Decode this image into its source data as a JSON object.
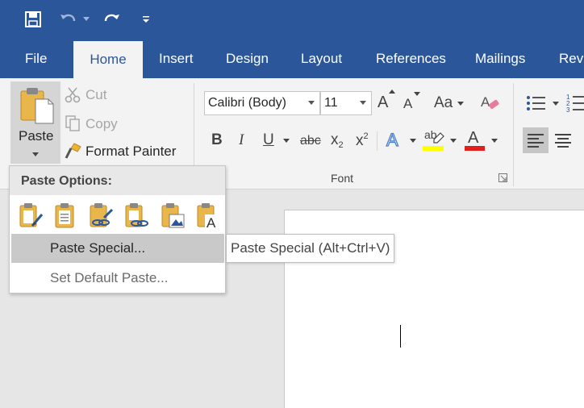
{
  "colors": {
    "accent": "#2b579a",
    "ribbon_bg": "#f3f3f3",
    "highlight_yellow": "#ffff00",
    "font_red": "#e0201f"
  },
  "qat": {
    "save_icon": "save-icon",
    "undo_icon": "undo-icon",
    "redo_icon": "redo-icon",
    "customize_icon": "customize-qat-icon"
  },
  "tabs": [
    {
      "label": "File"
    },
    {
      "label": "Home"
    },
    {
      "label": "Insert"
    },
    {
      "label": "Design"
    },
    {
      "label": "Layout"
    },
    {
      "label": "References"
    },
    {
      "label": "Mailings"
    },
    {
      "label": "Revi"
    }
  ],
  "clipboard": {
    "paste_label": "Paste",
    "cut_label": "Cut",
    "copy_label": "Copy",
    "format_painter_label": "Format Painter"
  },
  "font": {
    "font_name": "Calibri (Body)",
    "font_size": "11",
    "bold": "B",
    "italic": "I",
    "underline": "U",
    "strike": "abc",
    "subscript": "x",
    "sub_mark": "2",
    "superscript": "x",
    "sup_mark": "2",
    "group_label": "Font",
    "change_case": "Aa",
    "grow": "A",
    "shrink": "A",
    "effects": "A",
    "highlight": "ab",
    "font_color": "A"
  },
  "paste_menu": {
    "heading": "Paste Options:",
    "options": [
      "keep-source-formatting-icon",
      "merge-formatting-icon",
      "use-destination-styles-icon",
      "link-keep-source-icon",
      "picture-icon",
      "keep-text-only-icon"
    ],
    "paste_special": "Paste Special...",
    "set_default": "Set Default Paste..."
  },
  "tooltip": {
    "text": "Paste Special (Alt+Ctrl+V)"
  }
}
